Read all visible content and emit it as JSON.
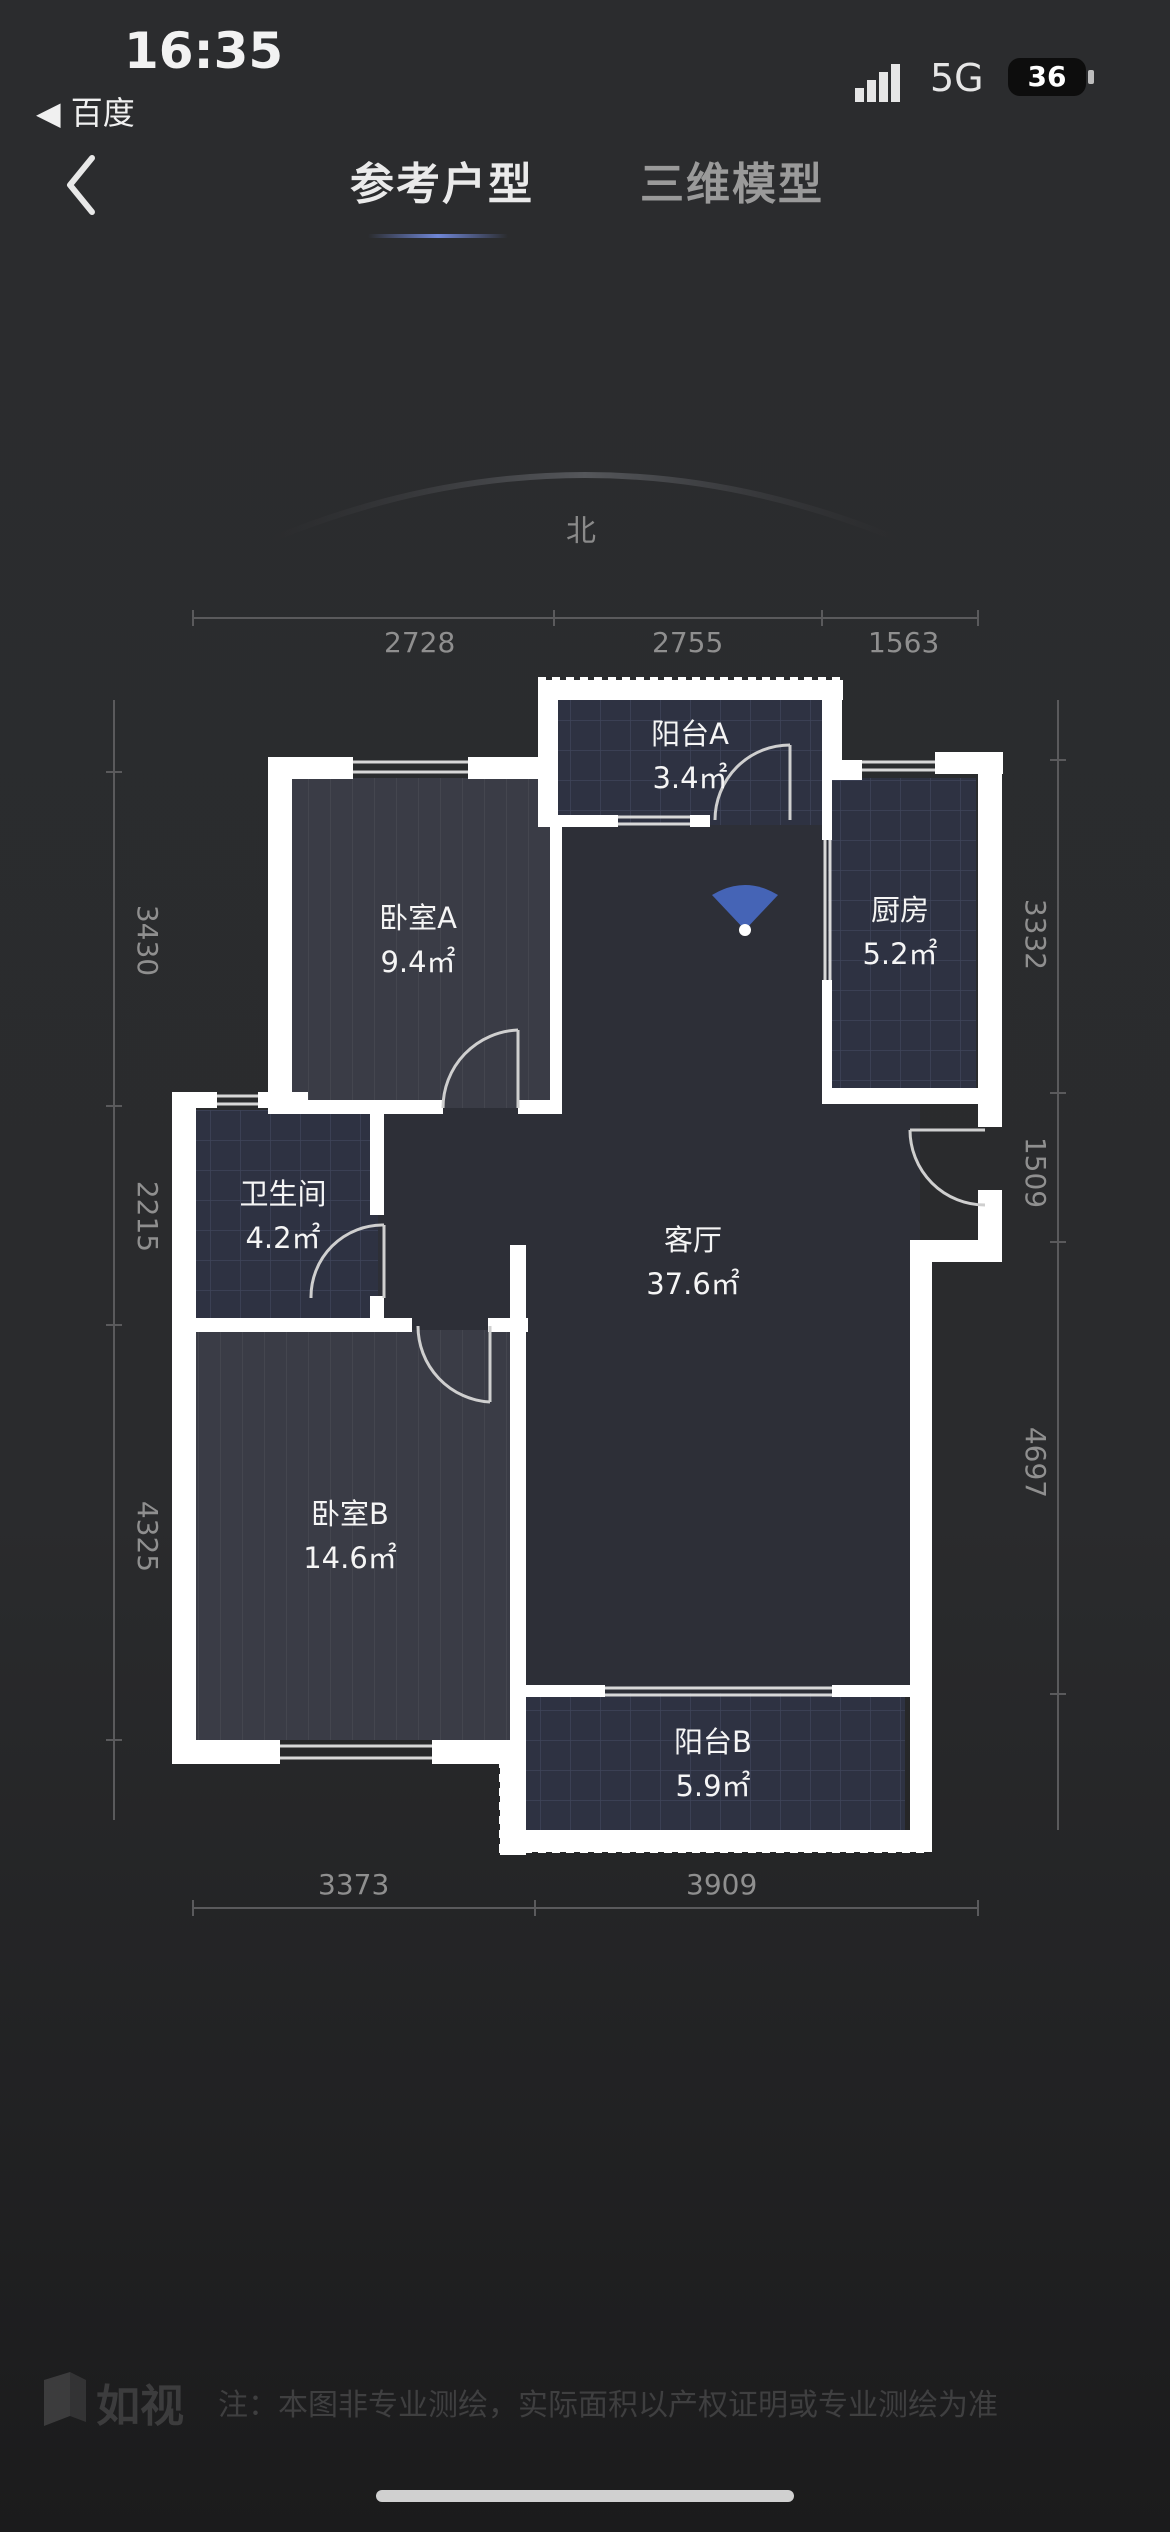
{
  "status_bar": {
    "time": "16:35",
    "back_app": "◀ 百度",
    "network": "5G",
    "battery": "36"
  },
  "nav": {
    "tabs": [
      {
        "label": "参考户型",
        "active": true
      },
      {
        "label": "三维模型",
        "active": false
      }
    ]
  },
  "compass": {
    "direction": "北"
  },
  "dimensions": {
    "top": [
      "2728",
      "2755",
      "1563"
    ],
    "bottom": [
      "3373",
      "3909"
    ],
    "left": [
      "3430",
      "2215",
      "4325"
    ],
    "right": [
      "3332",
      "1509",
      "4697"
    ]
  },
  "rooms": [
    {
      "name": "阳台A",
      "area": "3.4㎡"
    },
    {
      "name": "卧室A",
      "area": "9.4㎡"
    },
    {
      "name": "厨房",
      "area": "5.2㎡"
    },
    {
      "name": "卫生间",
      "area": "4.2㎡"
    },
    {
      "name": "客厅",
      "area": "37.6㎡"
    },
    {
      "name": "卧室B",
      "area": "14.6㎡"
    },
    {
      "name": "阳台B",
      "area": "5.9㎡"
    }
  ],
  "footer": {
    "logo_text": "如视",
    "note": "注：本图非专业测绘，实际面积以产权证明或专业测绘为准"
  },
  "colors": {
    "background": "#2b2c2e",
    "living_floor": "#2d2f37",
    "bedroom_floor": "#3a3c46",
    "tile_floor": "#2e3242",
    "wall": "#ffffff",
    "accent": "#6f86d6"
  }
}
